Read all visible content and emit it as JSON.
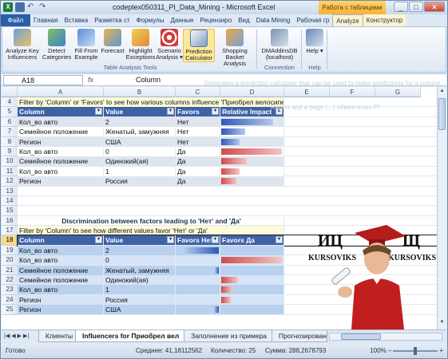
{
  "window": {
    "title": "codeplex050311_PI_Data_Mining - Microsoft Excel",
    "context_tab_group": "Работа с таблицами",
    "controls": [
      "_",
      "□",
      "✕"
    ]
  },
  "ribbon": {
    "tabs": [
      "Файл",
      "Главная",
      "Вставка",
      "Разметка ст",
      "Формулы",
      "Данные",
      "Рецензиро",
      "Вид",
      "Data Mining",
      "Рабочая гр",
      "Analyze",
      "Конструктор"
    ],
    "active_tab": "Analyze",
    "buttons": [
      {
        "label": "Analyze Key Influencers",
        "icon": "key-influencers-icon"
      },
      {
        "label": "Detect Categories",
        "icon": "detect-categories-icon"
      },
      {
        "label": "Fill From Example",
        "icon": "fill-example-icon"
      },
      {
        "label": "Forecast",
        "icon": "forecast-icon"
      },
      {
        "label": "Highlight Exceptions",
        "icon": "highlight-exceptions-icon"
      },
      {
        "label": "Scenario Analysis ▾",
        "icon": "scenario-icon"
      },
      {
        "label": "Prediction Calculator",
        "icon": "prediction-calculator-icon"
      },
      {
        "label": "Shopping Basket Analysis",
        "icon": "shopping-basket-icon"
      },
      {
        "label": "DMAddinsDB (localhost)",
        "icon": "connection-icon"
      },
      {
        "label": "Help ▾",
        "icon": "help-icon"
      }
    ],
    "groups": {
      "tools": "Table Analysis Tools",
      "connection": "Connection",
      "help": "Help"
    }
  },
  "formula_bar": {
    "name_box": "A18",
    "fx": "fx",
    "content": "Column",
    "ghost_tooltip": "Generates a prediction calculator that can be used to make predictions for a column.",
    "ghost_tooltip2": "Report and a page (...) обмен ключ PI"
  },
  "grid": {
    "columns": [
      "A",
      "B",
      "C",
      "D",
      "E",
      "F",
      "G"
    ],
    "rows": [
      "4",
      "5",
      "6",
      "7",
      "8",
      "9",
      "10",
      "11",
      "12",
      "13",
      "14",
      "15",
      "16",
      "17",
      "18",
      "19",
      "20",
      "21",
      "22",
      "23",
      "24",
      "25"
    ],
    "selected_row": "18",
    "banner1": "Filter by 'Column' or 'Favors' to see how various columns influence 'Приобрел велосипед'",
    "table1_headers": [
      "Column",
      "Value",
      "Favors",
      "Relative Impact"
    ],
    "table1_rows": [
      {
        "column": "Кол_во авто",
        "value": "2",
        "favors": "Нет",
        "impact": 0.85
      },
      {
        "column": "Семейное положение",
        "value": "Женатый, замужняя",
        "favors": "Нет",
        "impact": 0.4
      },
      {
        "column": "Регион",
        "value": "США",
        "favors": "Нет",
        "impact": 0.3
      },
      {
        "column": "Кол_во авто",
        "value": "0",
        "favors": "Да",
        "impact": 1.0
      },
      {
        "column": "Семейное положение",
        "value": "Одинокий(ая)",
        "favors": "Да",
        "impact": 0.42
      },
      {
        "column": "Кол_во авто",
        "value": "1",
        "favors": "Да",
        "impact": 0.3
      },
      {
        "column": "Регион",
        "value": "Россия",
        "favors": "Да",
        "impact": 0.25
      }
    ],
    "caption2": "Discrimination between factors leading to 'Нет' and 'Да'",
    "banner2": "Filter by 'Column' to see how different values favor 'Нет' or 'Да'",
    "table2_headers": [
      "Column",
      "Value",
      "Favors Нет",
      "Favors Да"
    ],
    "table2_rows": [
      {
        "column": "Кол_во авто",
        "value": "2",
        "net": 0.8,
        "da": 0
      },
      {
        "column": "Кол_во авто",
        "value": "0",
        "net": 0,
        "da": 1.0
      },
      {
        "column": "Семейное положение",
        "value": "Женатый, замужняя",
        "net": 0.1,
        "da": 0
      },
      {
        "column": "Семейное положение",
        "value": "Одинокий(ая)",
        "net": 0,
        "da": 0.28
      },
      {
        "column": "Кол_во авто",
        "value": "1",
        "net": 0,
        "da": 0.18
      },
      {
        "column": "Регион",
        "value": "Россия",
        "net": 0,
        "da": 0.16
      },
      {
        "column": "Регион",
        "value": "США",
        "net": 0.12,
        "da": 0
      }
    ]
  },
  "watermark": {
    "left": "ИЦ",
    "right": "Щ",
    "brand_left": "KURSOVIKS",
    "brand_right": "KURSOVIKS"
  },
  "sheets": [
    "Клиенты",
    "Influencers for Приобрел вел",
    "Заполнение из примера",
    "Прогнозирование"
  ],
  "active_sheet": "Influencers for Приобрел вел",
  "status": {
    "ready": "Готово",
    "average": "Среднее: 41,18112562",
    "count": "Количество: 25",
    "sum": "Сумма: 288,2678793",
    "zoom": "100%"
  },
  "colors": {
    "header_blue": "#3e62a6",
    "band_light": "#b9d1ee",
    "bar_blue": "#2c58b6",
    "bar_red": "#d04a4a"
  }
}
